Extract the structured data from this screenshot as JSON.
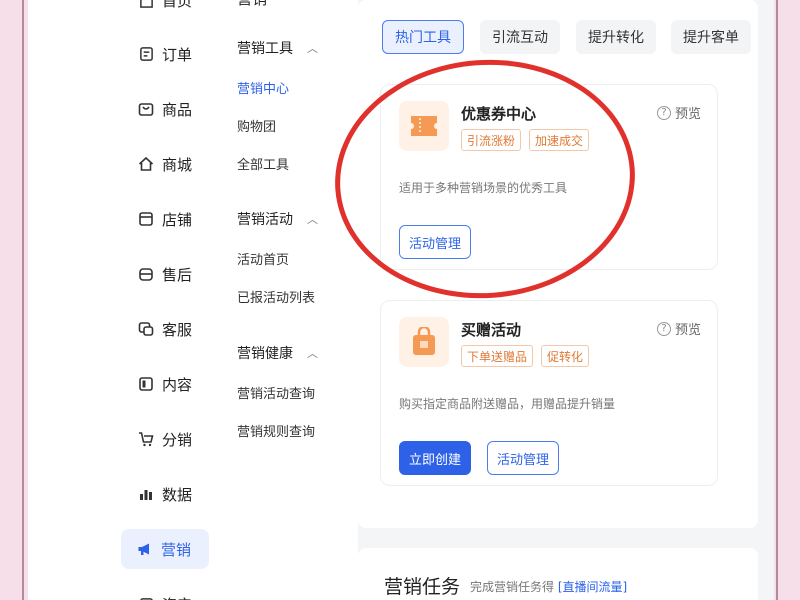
{
  "sidebar": {
    "items": [
      {
        "label": "首页",
        "icon": "home-icon"
      },
      {
        "label": "订单",
        "icon": "order-icon"
      },
      {
        "label": "商品",
        "icon": "product-icon"
      },
      {
        "label": "商城",
        "icon": "mall-icon"
      },
      {
        "label": "店铺",
        "icon": "store-icon"
      },
      {
        "label": "售后",
        "icon": "aftersale-icon"
      },
      {
        "label": "客服",
        "icon": "service-icon"
      },
      {
        "label": "内容",
        "icon": "content-icon"
      },
      {
        "label": "分销",
        "icon": "distribution-icon"
      },
      {
        "label": "数据",
        "icon": "data-icon"
      },
      {
        "label": "营销",
        "icon": "megaphone-icon"
      },
      {
        "label": "资产",
        "icon": "asset-icon"
      }
    ],
    "active": "营销"
  },
  "submenu": {
    "top_partial": "营销",
    "groups": [
      {
        "title": "营销工具",
        "items": [
          "营销中心",
          "购物团",
          "全部工具"
        ]
      },
      {
        "title": "营销活动",
        "items": [
          "活动首页",
          "已报活动列表"
        ]
      },
      {
        "title": "营销健康",
        "items": [
          "营销活动查询",
          "营销规则查询"
        ]
      }
    ],
    "active_item": "营销中心"
  },
  "tabs": [
    "热门工具",
    "引流互动",
    "提升转化",
    "提升客单"
  ],
  "active_tab": "热门工具",
  "cards": [
    {
      "title": "优惠券中心",
      "preview": "预览",
      "tags": [
        "引流涨粉",
        "加速成交"
      ],
      "desc": "适用于多种营销场景的优秀工具",
      "buttons": [
        "活动管理"
      ],
      "icon": "coupon-icon"
    },
    {
      "title": "买赠活动",
      "preview": "预览",
      "tags": [
        "下单送赠品",
        "促转化"
      ],
      "desc": "购买指定商品附送赠品，用赠品提升销量",
      "buttons": [
        "立即创建",
        "活动管理"
      ],
      "icon": "gift-bag-icon"
    }
  ],
  "tasks": {
    "title": "营销任务",
    "subtitle": "完成营销任务得",
    "link": "[直播间流量]"
  },
  "colors": {
    "accent": "#2d62e8",
    "tag_orange": "#e07a36",
    "annotation_red": "#e0312c",
    "background_pink": "#f6dfe9"
  }
}
